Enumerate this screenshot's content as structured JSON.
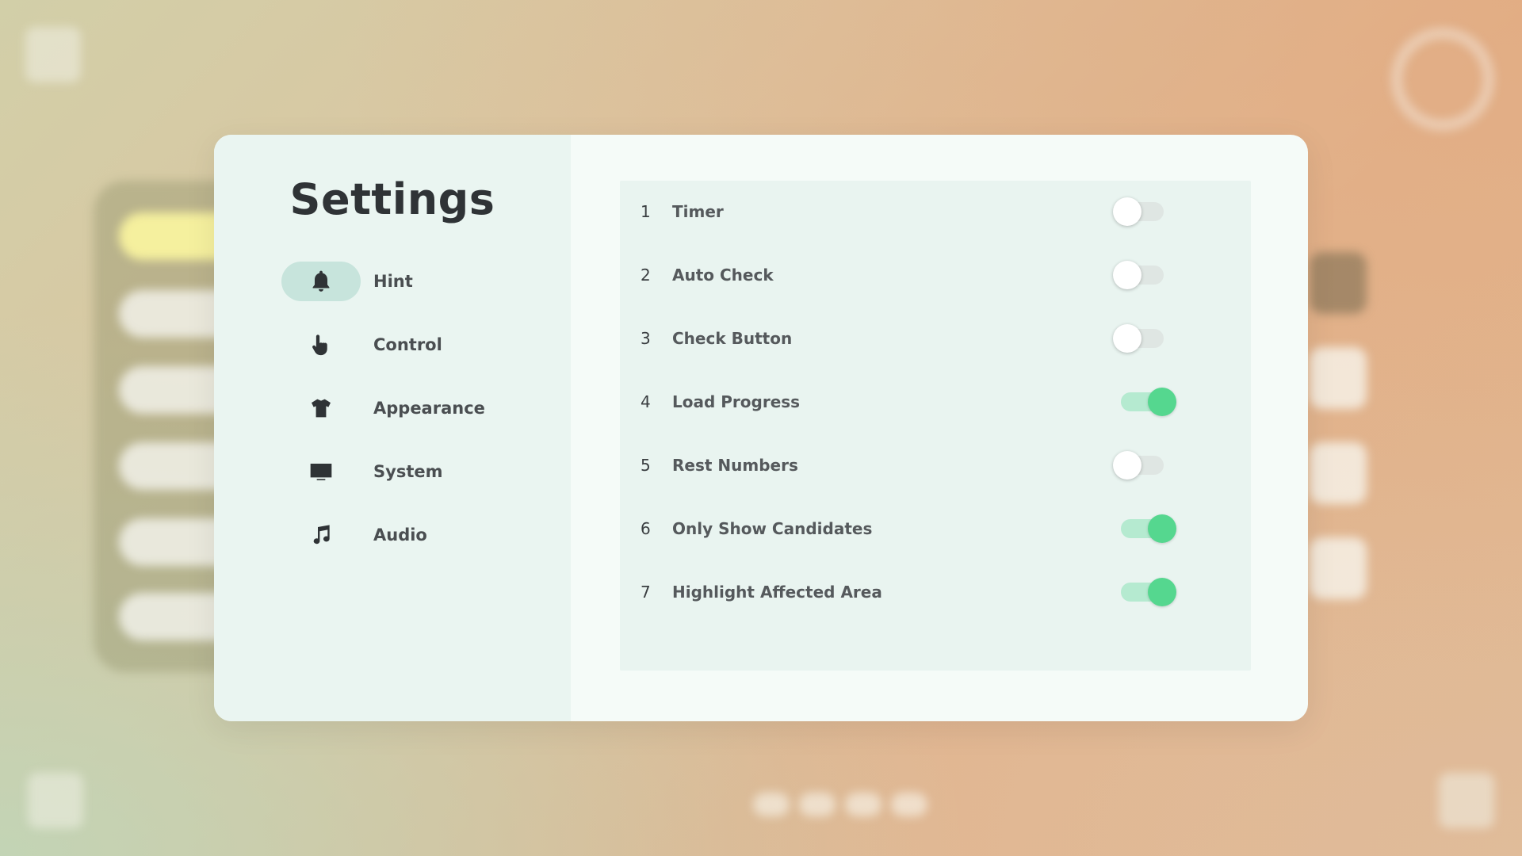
{
  "title": "Settings",
  "nav": [
    {
      "label": "Hint",
      "icon": "bell-icon",
      "active": true
    },
    {
      "label": "Control",
      "icon": "pointer-hand-icon",
      "active": false
    },
    {
      "label": "Appearance",
      "icon": "shirt-icon",
      "active": false
    },
    {
      "label": "System",
      "icon": "monitor-icon",
      "active": false
    },
    {
      "label": "Audio",
      "icon": "music-note-icon",
      "active": false
    }
  ],
  "options": [
    {
      "num": "1",
      "label": "Timer",
      "on": false
    },
    {
      "num": "2",
      "label": "Auto Check",
      "on": false
    },
    {
      "num": "3",
      "label": "Check Button",
      "on": false
    },
    {
      "num": "4",
      "label": "Load Progress",
      "on": true
    },
    {
      "num": "5",
      "label": "Rest Numbers",
      "on": false
    },
    {
      "num": "6",
      "label": "Only Show Candidates",
      "on": true
    },
    {
      "num": "7",
      "label": "Highlight Affected Area",
      "on": true
    }
  ],
  "colors": {
    "toggle_on": "#55d78f",
    "toggle_on_track": "#b5ead0",
    "active_nav_bg": "#c7e4dc",
    "sidebar_bg": "#eaf5f1",
    "panel_bg": "#e9f4f0"
  }
}
